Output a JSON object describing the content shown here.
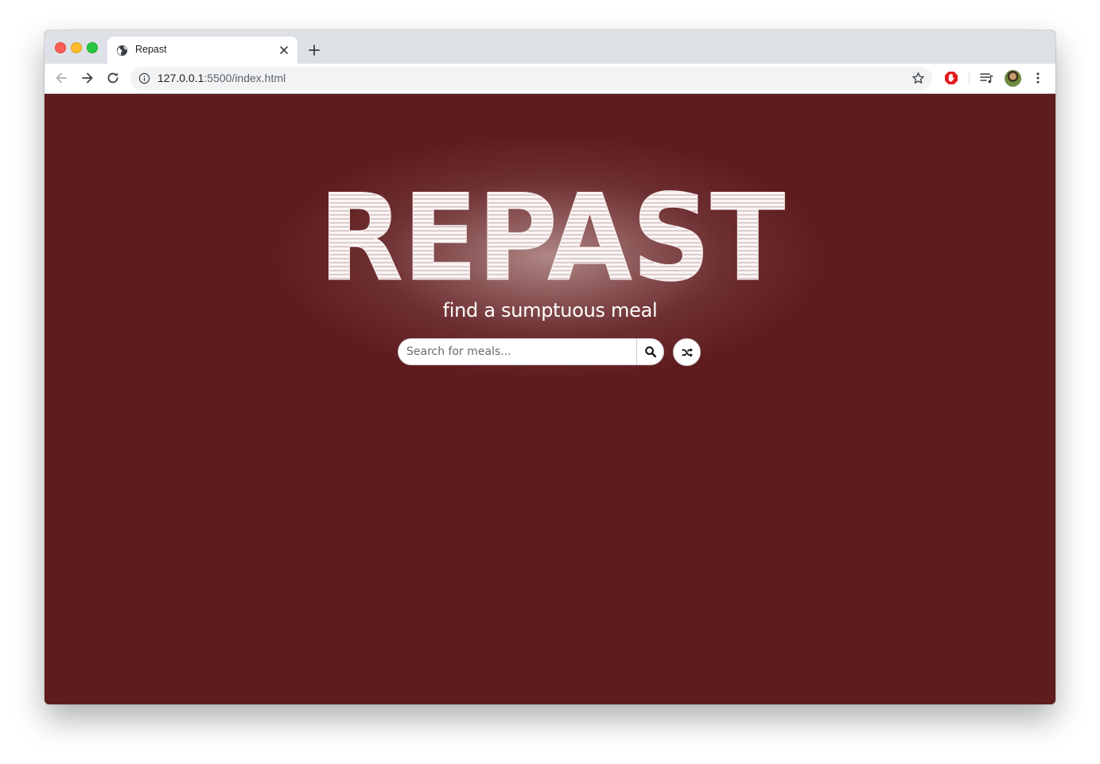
{
  "browser": {
    "tab_title": "Repast",
    "url_host": "127.0.0.1",
    "url_rest": ":5500/index.html",
    "new_tab_symbol": "+",
    "icons": {
      "favicon": "globe-icon",
      "tab_close": "close-icon",
      "back": "arrow-left-icon",
      "forward": "arrow-right-icon",
      "reload": "reload-icon",
      "site_info": "info-icon",
      "bookmark": "star-icon",
      "extension_1": "adblock-icon",
      "extension_2": "media-queue-icon",
      "profile": "avatar",
      "menu": "kebab-menu-icon"
    }
  },
  "page": {
    "logo_text": "REPAST",
    "tagline": "find a sumptuous meal",
    "search": {
      "placeholder": "Search for meals...",
      "value": ""
    },
    "buttons": {
      "search_icon": "search-icon",
      "random_icon": "shuffle-icon"
    },
    "colors": {
      "background": "#5e1c1e",
      "glow": "#b48c8c",
      "logo_fill": "#faf4f4",
      "logo_lines": "#a88080"
    }
  }
}
